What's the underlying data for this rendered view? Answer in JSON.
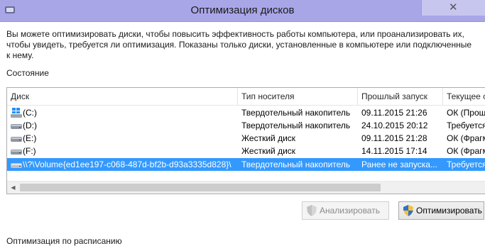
{
  "window": {
    "title": "Оптимизация дисков",
    "close_glyph": "✕"
  },
  "description": "Вы можете оптимизировать диски, чтобы повысить эффективность работы  компьютера, или проанализировать их, чтобы увидеть, требуется ли оптимизация. Показаны только диски, установленные в компьютере или подключенные к нему.",
  "status_section": {
    "label": "Состояние"
  },
  "table": {
    "columns": [
      "Диск",
      "Тип носителя",
      "Прошлый запуск",
      "Текущее с"
    ],
    "rows": [
      {
        "name": "(C:)",
        "icon": "windows-drive-icon",
        "media": "Твердотельный накопитель",
        "last_run": "09.11.2015 21:26",
        "status": "ОК (Проще",
        "selected": false
      },
      {
        "name": "(D:)",
        "icon": "drive-icon",
        "media": "Твердотельный накопитель",
        "last_run": "24.10.2015 20:12",
        "status": "Требуется",
        "selected": false
      },
      {
        "name": "(E:)",
        "icon": "drive-icon",
        "media": "Жесткий диск",
        "last_run": "09.11.2015 21:28",
        "status": "ОК (Фрагм",
        "selected": false
      },
      {
        "name": "(F:)",
        "icon": "drive-icon",
        "media": "Жесткий диск",
        "last_run": "14.11.2015 17:14",
        "status": "ОК (Фрагм",
        "selected": false
      },
      {
        "name": "\\\\?\\Volume{ed1ee197-c068-487d-bf2b-d93a3335d828}\\",
        "icon": "drive-icon",
        "media": "Твердотельный накопитель",
        "last_run": "Ранее не запуска...",
        "status": "Требуется",
        "selected": true
      }
    ]
  },
  "buttons": {
    "analyze": "Анализировать",
    "optimize": "Оптимизировать"
  },
  "schedule_section": {
    "label": "Оптимизация по расписанию"
  },
  "colors": {
    "titlebar": "#a9a6e8",
    "selection": "#3399ff"
  }
}
